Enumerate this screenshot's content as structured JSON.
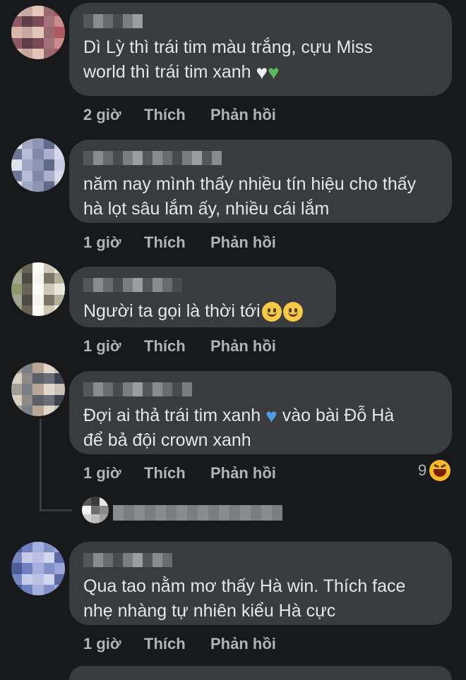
{
  "comments": [
    {
      "text": "Dì Lỳ thì trái tim màu trắng, cựu Miss world thì trái tim xanh",
      "text_line1": "Dì Lỳ thì trái tim màu trắng, cựu Miss",
      "text_line2": "world thì trái tim xanh",
      "icons": [
        "white-heart-icon",
        "green-heart-icon"
      ],
      "time": "2 giờ",
      "like": "Thích",
      "reply": "Phản hồi"
    },
    {
      "text_line1": "năm nay mình thấy nhiều tín hiệu cho thấy",
      "text_line2": "hà lọt sâu lắm ấy, nhiều cái lắm",
      "time": "1 giờ",
      "like": "Thích",
      "reply": "Phản hồi"
    },
    {
      "text_line1": "Người ta gọi là thời tới",
      "icons": [
        "slightly-smiling-face-icon",
        "slightly-smiling-face-icon"
      ],
      "time": "1 giờ",
      "like": "Thích",
      "reply": "Phản hồi"
    },
    {
      "text_line1": "Đợi ai thả trái tim xanh",
      "text_line1b": "vào bài Đỗ Hà",
      "text_line2": "để bả đội crown xanh",
      "icons": [
        "blue-heart-icon"
      ],
      "time": "1 giờ",
      "like": "Thích",
      "reply": "Phản hồi",
      "reaction_count": "9",
      "reaction_icon": "laughing-face-icon"
    },
    {
      "text_line1": "Qua tao nằm mơ thấy Hà win. Thích face",
      "text_line2": "nhẹ nhàng tự nhiên kiểu Hà cực",
      "time": "1 giờ",
      "like": "Thích",
      "reply": "Phản hồi"
    }
  ],
  "colors": {
    "background": "#18191a",
    "bubble": "#3a3b3c",
    "text": "#e4e6eb",
    "meta": "#b0b3b8"
  }
}
